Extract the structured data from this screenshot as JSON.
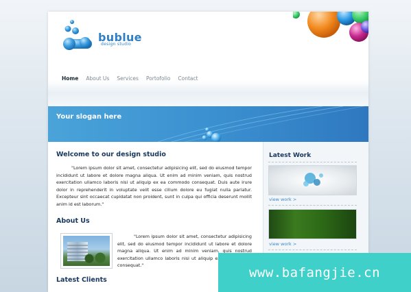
{
  "brand": {
    "name": "bublue",
    "tagline": "design studio"
  },
  "nav": {
    "items": [
      "Home",
      "About Us",
      "Services",
      "Portofolio",
      "Contact"
    ],
    "active": "Home"
  },
  "banner": {
    "slogan": "Your slogan here"
  },
  "main": {
    "welcome_title": "Welcome to our design studio",
    "welcome_text": "\"Lorem ipsum dolor sit amet, consectetur adipisicing elit, sed do eiusmod tempor incididunt ut labore et dolore magna aliqua. Ut enim ad minim veniam, quis nostrud exercitation ullamco laboris nisi ut aliquip ex ea commodo consequat. Duis aute irure dolor in reprehenderit in voluptate velit esse cillum dolore eu fugiat nulla pariatur. Excepteur sint occaecat cupidatat non proident, sunt in culpa qui officia deserunt mollit anim id est laborum.\"",
    "about_title": "About Us",
    "about_text": "\"Lorem ipsum dolor sit amet, consectetur adipisicing elit, sed do eiusmod tempor incididunt ut labore et dolore magna aliqua. Ut enim ad minim veniam, quis nostrud exercitation ullamco laboris nisi ut aliquip ex ea commodo consequat.\"",
    "clients_title": "Latest Clients"
  },
  "sidebar": {
    "title": "Latest Work",
    "items": [
      {
        "link": "view work >"
      },
      {
        "link": "view work >"
      }
    ]
  },
  "watermark": {
    "text": "www.bafangjie.cn"
  },
  "colors": {
    "accent": "#2f7fc4",
    "heading": "#17375e",
    "banner": "#3a8fcf",
    "watermark_bg": "#3fd1c9"
  }
}
